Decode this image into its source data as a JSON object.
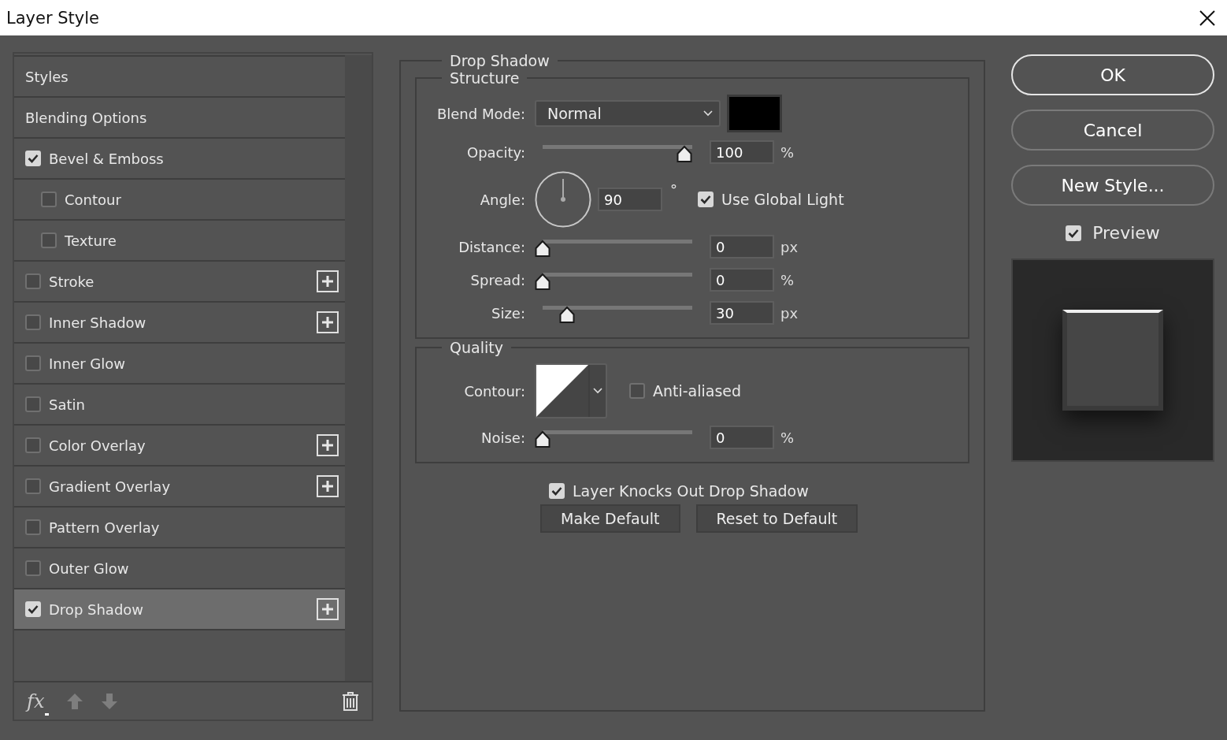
{
  "window": {
    "title": "Layer Style"
  },
  "styles_panel": {
    "items": [
      {
        "label": "Styles",
        "kind": "header",
        "selected": false
      },
      {
        "label": "Blending Options",
        "kind": "header",
        "selected": false
      },
      {
        "label": "Bevel & Emboss",
        "kind": "effect",
        "checked": true,
        "selected": false,
        "add_button": false,
        "children": [
          {
            "label": "Contour",
            "kind": "effect",
            "checked": false,
            "selected": false,
            "add_button": false
          },
          {
            "label": "Texture",
            "kind": "effect",
            "checked": false,
            "selected": false,
            "add_button": false
          }
        ]
      },
      {
        "label": "Stroke",
        "kind": "effect",
        "checked": false,
        "selected": false,
        "add_button": true
      },
      {
        "label": "Inner Shadow",
        "kind": "effect",
        "checked": false,
        "selected": false,
        "add_button": true
      },
      {
        "label": "Inner Glow",
        "kind": "effect",
        "checked": false,
        "selected": false,
        "add_button": false
      },
      {
        "label": "Satin",
        "kind": "effect",
        "checked": false,
        "selected": false,
        "add_button": false
      },
      {
        "label": "Color Overlay",
        "kind": "effect",
        "checked": false,
        "selected": false,
        "add_button": true
      },
      {
        "label": "Gradient Overlay",
        "kind": "effect",
        "checked": false,
        "selected": false,
        "add_button": true
      },
      {
        "label": "Pattern Overlay",
        "kind": "effect",
        "checked": false,
        "selected": false,
        "add_button": false
      },
      {
        "label": "Outer Glow",
        "kind": "effect",
        "checked": false,
        "selected": false,
        "add_button": false
      },
      {
        "label": "Drop Shadow",
        "kind": "effect",
        "checked": true,
        "selected": true,
        "add_button": true
      }
    ],
    "footer": {
      "fx_label": "fx",
      "move_up_disabled": true,
      "move_down_disabled": true
    }
  },
  "effect_panel": {
    "title": "Drop Shadow",
    "structure": {
      "title": "Structure",
      "blend_mode": {
        "label": "Blend Mode:",
        "value": "Normal",
        "color": "#000000"
      },
      "opacity": {
        "label": "Opacity:",
        "level": 1,
        "value": "100",
        "unit": "%"
      },
      "angle": {
        "label": "Angle:",
        "value": "90",
        "unit": "°",
        "use_global_light": {
          "label": "Use Global Light",
          "checked": true
        }
      },
      "distance": {
        "label": "Distance:",
        "level": 0,
        "value": "0",
        "unit": "px"
      },
      "spread": {
        "label": "Spread:",
        "level": 0,
        "value": "0",
        "unit": "%"
      },
      "size": {
        "label": "Size:",
        "level": 0.17,
        "value": "30",
        "unit": "px"
      }
    },
    "quality": {
      "title": "Quality",
      "contour": {
        "label": "Contour:"
      },
      "anti_aliased": {
        "label": "Anti-aliased",
        "checked": false
      },
      "noise": {
        "label": "Noise:",
        "level": 0,
        "value": "0",
        "unit": "%"
      }
    },
    "knockout": {
      "label": "Layer Knocks Out Drop Shadow",
      "checked": true
    },
    "buttons": [
      "Make Default",
      "Reset to Default"
    ]
  },
  "actions": {
    "buttons": [
      {
        "label": "OK",
        "default": true
      },
      {
        "label": "Cancel",
        "default": false
      },
      {
        "label": "New Style...",
        "default": false
      }
    ],
    "preview": {
      "label": "Preview",
      "checked": true
    }
  }
}
